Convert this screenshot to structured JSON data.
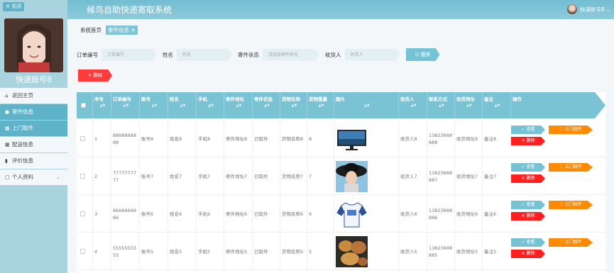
{
  "app": {
    "title": "候鸟自助快递寄取系统"
  },
  "user": {
    "name": "快递账号8",
    "chevron": "⌄"
  },
  "sidebar": {
    "close_label": "关闭",
    "account_name": "快递账号8",
    "items": [
      {
        "label": "返回主页",
        "icon": "home-icon"
      },
      {
        "label": "寄件信息",
        "icon": "user-icon"
      },
      {
        "label": "上门取件",
        "icon": "grid-icon"
      },
      {
        "label": "配送信息",
        "icon": "grid-icon"
      },
      {
        "label": "评价信息",
        "icon": "trash-icon"
      },
      {
        "label": "个人资料",
        "icon": "calendar-icon"
      }
    ]
  },
  "breadcrumb": {
    "home": "系统首页",
    "tab": "寄件信息"
  },
  "search": {
    "order_label": "订单编号",
    "order_placeholder": "订单编号",
    "name_label": "姓名",
    "name_placeholder": "姓名",
    "status_label": "寄件状态",
    "status_placeholder": "请选择寄件状态",
    "receiver_label": "收货人",
    "receiver_placeholder": "收货人",
    "button": "搜索"
  },
  "toolbar": {
    "delete_label": "删除"
  },
  "table": {
    "headers": [
      "序号",
      "订单编号",
      "账号",
      "姓名",
      "手机",
      "寄件地址",
      "寄件状态",
      "货物名称",
      "货物重量",
      "图片",
      "收货人",
      "联系方式",
      "收货地址",
      "备注",
      "操作"
    ],
    "actions": {
      "view": "查看",
      "pickup": "上门取件",
      "delete": "删除"
    },
    "rows": [
      {
        "no": "1",
        "order": "8888888888",
        "account": "账号8",
        "name": "姓名8",
        "phone": "手机8",
        "address": "寄件地址8",
        "status": "已取件",
        "goods": "货物名称8",
        "weight": "8",
        "image": "monitor",
        "receiver": "收货人8",
        "contact": "13823888888",
        "recv_addr": "收货地址8",
        "note": "备注8"
      },
      {
        "no": "2",
        "order": "7777777777",
        "account": "账号7",
        "name": "姓名7",
        "phone": "手机7",
        "address": "寄件地址7",
        "status": "已取件",
        "goods": "货物名称7",
        "weight": "7",
        "image": "hat",
        "receiver": "收货人7",
        "contact": "13823888887",
        "recv_addr": "收货地址7",
        "note": "备注7"
      },
      {
        "no": "3",
        "order": "6666666666",
        "account": "账号6",
        "name": "姓名6",
        "phone": "手机6",
        "address": "寄件地址6",
        "status": "已取件",
        "goods": "货物名称6",
        "weight": "6",
        "image": "shirt",
        "receiver": "收货人6",
        "contact": "13823888886",
        "recv_addr": "收货地址6",
        "note": "备注6"
      },
      {
        "no": "4",
        "order": "5555555555",
        "account": "账号5",
        "name": "姓名5",
        "phone": "手机5",
        "address": "寄件地址5",
        "status": "已取件",
        "goods": "货物名称5",
        "weight": "5",
        "image": "food",
        "receiver": "收货人5",
        "contact": "13823888885",
        "recv_addr": "收货地址5",
        "note": "备注5"
      }
    ]
  }
}
